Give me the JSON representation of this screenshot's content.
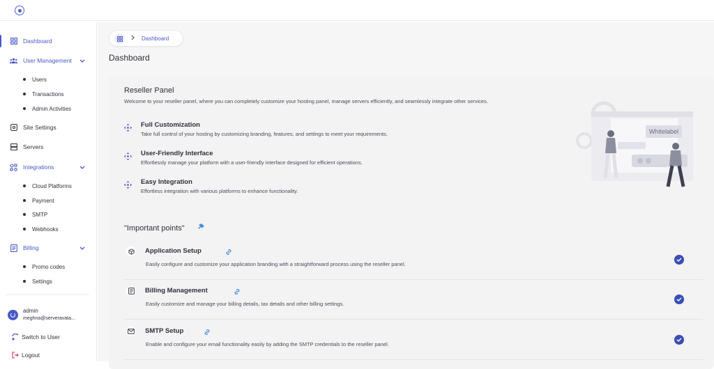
{
  "sidebar": {
    "items": [
      {
        "label": "Dashboard"
      },
      {
        "label": "User Management"
      },
      {
        "label": "Site Settings"
      },
      {
        "label": "Servers"
      },
      {
        "label": "Integrations"
      },
      {
        "label": "Billing"
      }
    ],
    "user_management_sub": [
      "Users",
      "Transactions",
      "Admin Activities"
    ],
    "integrations_sub": [
      "Cloud Platforms",
      "Payment",
      "SMTP",
      "Webhooks"
    ],
    "billing_sub": [
      "Promo codes",
      "Settings"
    ],
    "user": {
      "name": "admin",
      "email": "meghna@serveravata..."
    },
    "switch_label": "Switch to User",
    "logout_label": "Logout"
  },
  "breadcrumb": {
    "label": "Dashboard"
  },
  "page_title": "Dashboard",
  "reseller": {
    "title": "Reseller Panel",
    "description": "Welcome to your reseller panel, where you can completely customize your hosting panel, manage servers efficiently, and seamlessly integrate other services.",
    "features": [
      {
        "title": "Full Customization",
        "desc": "Take full control of your hosting by customizing branding, features, and settings to meet your requirements."
      },
      {
        "title": "User-Friendly Interface",
        "desc": "Effortlessly manage your platform with a user-friendly interface designed for efficient operations."
      },
      {
        "title": "Easy Integration",
        "desc": "Effortless integration with various platforms to enhance functionality."
      }
    ],
    "illustration_label": "Whitelabel"
  },
  "important": {
    "title": "\"Important points\"",
    "items": [
      {
        "title": "Application Setup",
        "desc": "Easily configure and customize your application branding with a straightforward process using the reseller panel."
      },
      {
        "title": "Billing Management",
        "desc": "Easily customize and manage your billing details, tax details and other billing settings."
      },
      {
        "title": "SMTP Setup",
        "desc": "Enable and configure your email functionality easily by adding the SMTP credentials to the reseller panel."
      }
    ]
  },
  "colors": {
    "accent": "#4a58c9",
    "check": "#3c4db6",
    "link": "#4a8ad8"
  }
}
